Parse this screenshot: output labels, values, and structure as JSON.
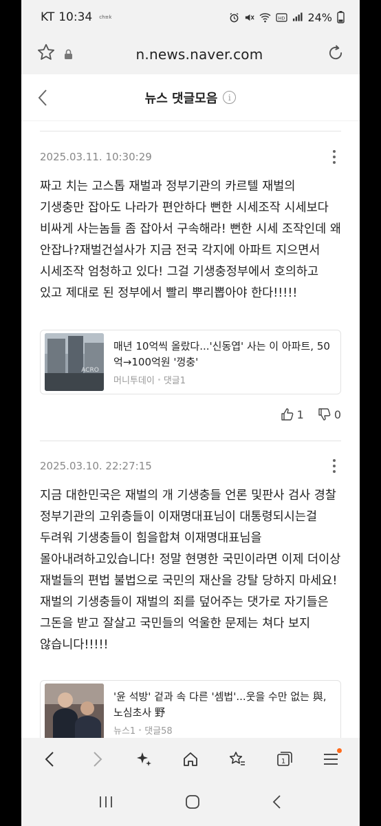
{
  "status_bar": {
    "carrier": "KT",
    "time": "10:34",
    "carrier_mini": "ch≡k",
    "battery": "24%",
    "icons": [
      "alarm-icon",
      "mute-icon",
      "wifi-icon",
      "hd-icon",
      "signal-icon"
    ]
  },
  "browser": {
    "url": "n.news.naver.com",
    "icons": [
      "bookmark-star-icon",
      "lock-icon",
      "reload-icon"
    ]
  },
  "header": {
    "title": "뉴스 댓글모음",
    "info_icon": "i"
  },
  "comments": [
    {
      "date": "2025.03.11. 10:30:29",
      "text": "짜고 치는 고스톱 재벌과 정부기관의 카르텔 재벌의 기생충만 잡아도 나라가 편안하다 뻔한 시세조작 시세보다 비싸게 사는놈들 좀 잡아서 구속해라! 뻔한 시세 조작인데 왜 안잡나?재벌건설사가 지금 전국 각지에 아파트 지으면서 시세조작 엄청하고 있다! 그걸 기생충정부에서 호의하고 있고 제대로 된 정부에서 빨리 뿌리뽑아야 한다!!!!!",
      "article": {
        "headline": "매년 10억씩 올랐다...'신동엽' 사는 이 아파트, 50억→100억원 '껑충'",
        "source": "머니투데이",
        "comment_count": "댓글1",
        "thumb_sign": "ACRO"
      },
      "likes": "1",
      "dislikes": "0"
    },
    {
      "date": "2025.03.10. 22:27:15",
      "text": "지금 대한민국은 재벌의 개 기생충들 언론 및판사 검사 경찰 정부기관의 고위층들이 이재명대표님이 대통령되시는걸 두려워 기생충들이 힘을합쳐 이재명대표님을 몰아내려하고있습니다! 정말 현명한 국민이라면 이제 더이상 재벌들의 편법 불법으로 국민의 재산을 강탈 당하지 마세요! 재벌의 기생충들이 재벌의 죄를 덮어주는 댓가로 자기들은 그돈을 받고 잘살고 국민들의 억울한 문제는 쳐다 보지 않습니다!!!!!",
      "article": {
        "headline": "'윤 석방' 겉과 속 다른 '셈법'...웃을 수만 없는 與, 노심초사 野",
        "source": "뉴스1",
        "comment_count": "댓글58"
      }
    }
  ],
  "toolbar": {
    "icons": [
      "back-icon",
      "forward-icon",
      "sparkle-icon",
      "home-icon",
      "bookmarks-icon",
      "tabs-icon",
      "menu-icon"
    ],
    "tab_count": "1",
    "accent": "#ff6a1a"
  },
  "navbar": {
    "icons": [
      "recent-apps-icon",
      "home-nav-icon",
      "back-nav-icon"
    ]
  }
}
